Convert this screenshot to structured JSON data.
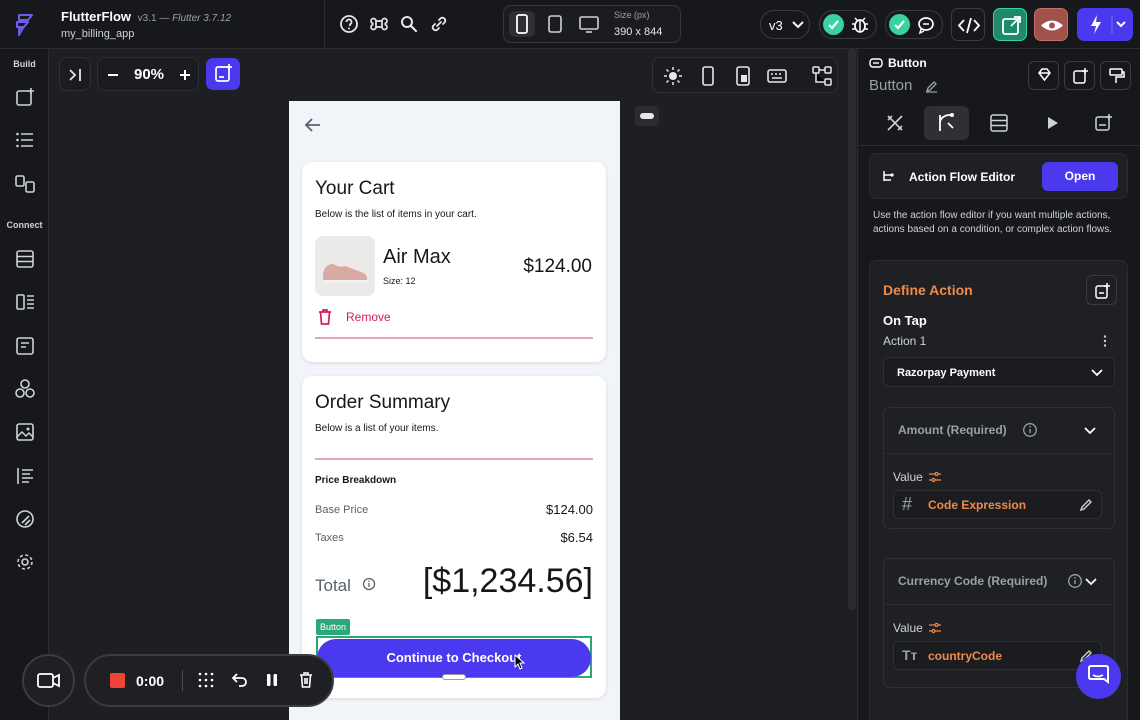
{
  "header": {
    "app_name": "FlutterFlow",
    "app_version": "v3.1",
    "dash": "—",
    "flutter_version": "Flutter 3.7.12",
    "project_name": "my_billing_app",
    "size_label": "Size (px)",
    "size_value": "390 x 844",
    "version_selector": "v3"
  },
  "left_rail": {
    "build_label": "Build",
    "connect_label": "Connect"
  },
  "canvas": {
    "zoom": "90%"
  },
  "cart": {
    "title": "Your Cart",
    "subtitle": "Below is the list of items in your cart.",
    "item_name": "Air Max",
    "item_size": "Size: 12",
    "item_price": "$124.00",
    "remove_label": "Remove"
  },
  "summary": {
    "title": "Order Summary",
    "subtitle": "Below is a list of your items.",
    "breakdown_label": "Price Breakdown",
    "base_price_label": "Base Price",
    "base_price_value": "$124.00",
    "taxes_label": "Taxes",
    "taxes_value": "$6.54",
    "total_label": "Total",
    "total_value": "[$1,234.56]",
    "button_tag": "Button",
    "checkout_label": "Continue to Checkout"
  },
  "panel": {
    "widget_type": "Button",
    "widget_name": "Button",
    "action_flow_title": "Action Flow Editor",
    "open_label": "Open",
    "action_flow_help": "Use the action flow editor if you want multiple actions, actions based on a condition, or complex action flows.",
    "define_action": "Define Action",
    "trigger": "On Tap",
    "action_index": "Action 1",
    "action_selected": "Razorpay Payment",
    "amount_label": "Amount (Required)",
    "amount_value_label": "Value",
    "amount_value": "Code Expression",
    "currency_label": "Currency Code (Required)",
    "currency_value_label": "Value",
    "currency_value": "countryCode"
  },
  "recorder": {
    "timer": "0:00"
  },
  "colors": {
    "accent": "#4b39ef",
    "selection": "#2aa879",
    "orange": "#f08a4b",
    "remove": "#d81b60"
  }
}
